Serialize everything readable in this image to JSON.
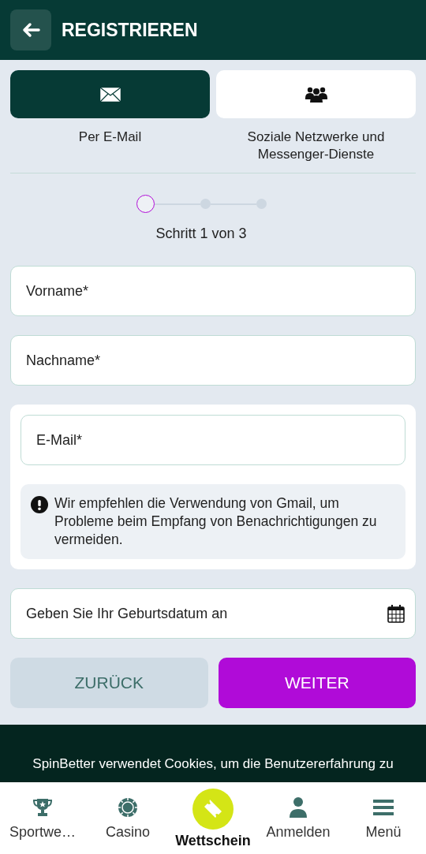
{
  "header": {
    "title": "REGISTRIEREN"
  },
  "tabs": [
    {
      "kind": "email",
      "label": "Per E-Mail",
      "selected": true
    },
    {
      "kind": "social",
      "label": "Soziale Netzwerke und Messenger-Dienste",
      "selected": false
    }
  ],
  "stepper": {
    "steps": [
      {
        "current": true
      },
      {
        "current": false
      },
      {
        "current": false
      }
    ],
    "label": "Schritt 1 von 3"
  },
  "fields": [
    {
      "kind": "text",
      "placeholder": "Vorname*"
    },
    {
      "kind": "text",
      "placeholder": "Nachname*"
    },
    {
      "kind": "email",
      "placeholder": "E-Mail*",
      "note": "Wir empfehlen die Verwendung von Gmail, um Probleme beim Empfang von Benachrichtigungen zu vermeiden."
    },
    {
      "kind": "date",
      "placeholder": "Geben Sie Ihr Geburtsdatum an"
    }
  ],
  "buttons": [
    {
      "kind": "secondary",
      "label": "ZURÜCK"
    },
    {
      "kind": "primary",
      "label": "WEITER"
    }
  ],
  "cookie_banner": {
    "lines": [
      "SpinBetter verwendet Cookies, um die Benutzererfahrung zu"
    ]
  },
  "bottom_nav": [
    {
      "kind": "trophy",
      "label": "Sportwe…",
      "selected": false
    },
    {
      "kind": "chip",
      "label": "Casino",
      "selected": false
    },
    {
      "kind": "ticket",
      "label": "Wettschein",
      "selected": true
    },
    {
      "kind": "user",
      "label": "Anmelden",
      "selected": false
    },
    {
      "kind": "menu",
      "label": "Menü",
      "selected": false
    }
  ]
}
